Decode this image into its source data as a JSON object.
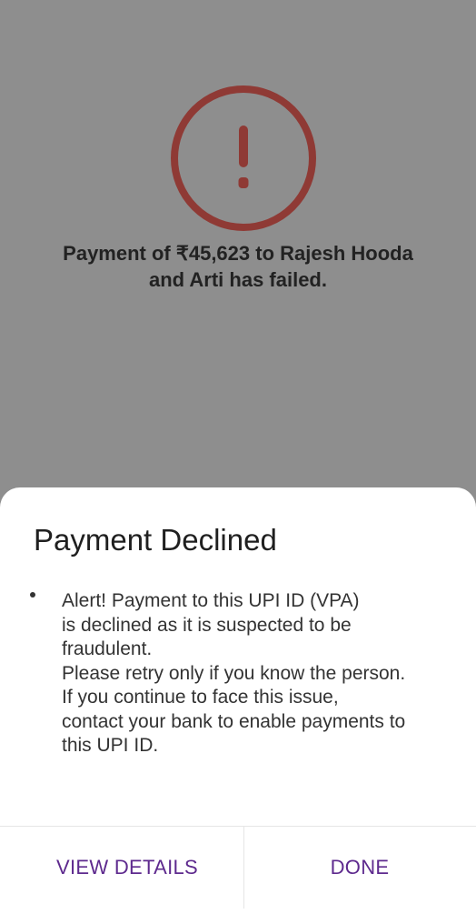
{
  "failure": {
    "message_line1": "Payment of ₹45,623 to Rajesh Hooda",
    "message_line2": "and Arti has failed.",
    "icon": "exclamation-circle-icon",
    "icon_color": "#8f3a35"
  },
  "dialog": {
    "title": "Payment Declined",
    "alert_lines": [
      "Alert! Payment to this UPI ID (VPA)",
      "is declined as it is suspected to be",
      "fraudulent.",
      "Please retry only if you know the person.",
      "If you continue to face this issue,",
      "contact your bank to enable payments to",
      "this UPI ID."
    ],
    "view_details_label": "VIEW DETAILS",
    "done_label": "DONE",
    "accent_color": "#5e2a8e"
  }
}
